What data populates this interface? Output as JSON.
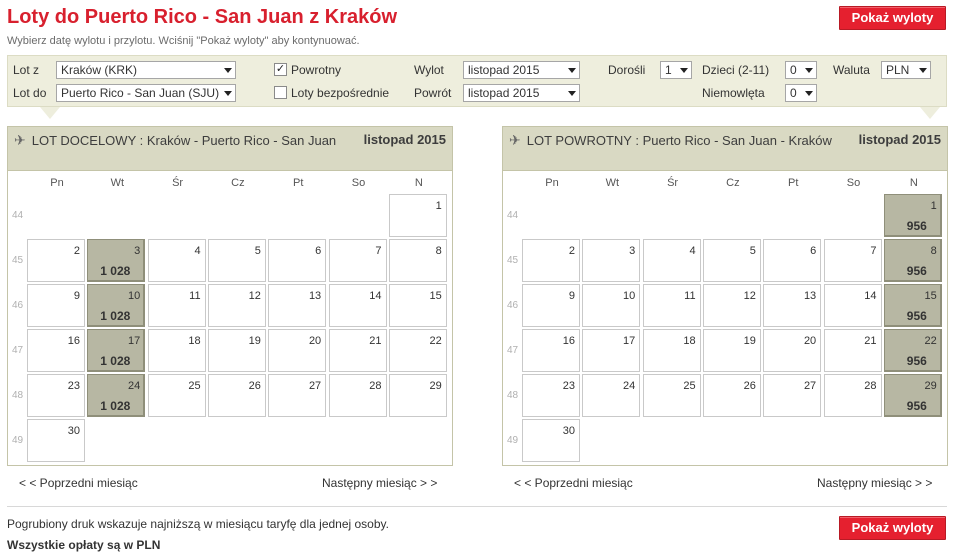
{
  "header": {
    "title": "Loty do Puerto Rico - San Juan z Kraków",
    "subtitle": "Wybierz datę wylotu i przylotu. Wciśnij \"Pokaż wyloty\" aby kontynuować.",
    "show_button": "Pokaż wyloty"
  },
  "form": {
    "from_label": "Lot z",
    "from_value": "Kraków (KRK)",
    "to_label": "Lot do",
    "to_value": "Puerto Rico - San Juan (SJU)",
    "return_label": "Powrotny",
    "return_checked": "✓",
    "direct_label": "Loty bezpośrednie",
    "direct_checked": "",
    "depart_label": "Wylot",
    "depart_value": "listopad 2015",
    "return_date_label": "Powrót",
    "return_date_value": "listopad 2015",
    "adults_label": "Dorośli",
    "adults_value": "1",
    "children_label": "Dzieci (2-11)",
    "children_value": "0",
    "infants_label": "Niemowlęta",
    "infants_value": "0",
    "currency_label": "Waluta",
    "currency_value": "PLN"
  },
  "weekdays": [
    "Pn",
    "Wt",
    "Śr",
    "Cz",
    "Pt",
    "So",
    "N"
  ],
  "calendars": [
    {
      "label": "LOT DOCELOWY :",
      "route": "Kraków - Puerto Rico - San Juan",
      "month": "listopad 2015",
      "week_numbers": [
        "44",
        "45",
        "46",
        "47",
        "48",
        "49"
      ],
      "weeks": [
        [
          null,
          null,
          null,
          null,
          null,
          null,
          {
            "day": "1"
          }
        ],
        [
          {
            "day": "2"
          },
          {
            "day": "3",
            "price": "1 028"
          },
          {
            "day": "4"
          },
          {
            "day": "5"
          },
          {
            "day": "6"
          },
          {
            "day": "7"
          },
          {
            "day": "8"
          }
        ],
        [
          {
            "day": "9"
          },
          {
            "day": "10",
            "price": "1 028"
          },
          {
            "day": "11"
          },
          {
            "day": "12"
          },
          {
            "day": "13"
          },
          {
            "day": "14"
          },
          {
            "day": "15"
          }
        ],
        [
          {
            "day": "16"
          },
          {
            "day": "17",
            "price": "1 028"
          },
          {
            "day": "18"
          },
          {
            "day": "19"
          },
          {
            "day": "20"
          },
          {
            "day": "21"
          },
          {
            "day": "22"
          }
        ],
        [
          {
            "day": "23"
          },
          {
            "day": "24",
            "price": "1 028"
          },
          {
            "day": "25"
          },
          {
            "day": "26"
          },
          {
            "day": "27"
          },
          {
            "day": "28"
          },
          {
            "day": "29"
          }
        ],
        [
          {
            "day": "30"
          },
          null,
          null,
          null,
          null,
          null,
          null
        ]
      ],
      "prev": "< < Poprzedni miesiąc",
      "next": "Następny miesiąc > >"
    },
    {
      "label": "LOT POWROTNY :",
      "route": "Puerto Rico - San Juan - Kraków",
      "month": "listopad 2015",
      "week_numbers": [
        "44",
        "45",
        "46",
        "47",
        "48",
        "49"
      ],
      "weeks": [
        [
          null,
          null,
          null,
          null,
          null,
          null,
          {
            "day": "1",
            "price": "956"
          }
        ],
        [
          {
            "day": "2"
          },
          {
            "day": "3"
          },
          {
            "day": "4"
          },
          {
            "day": "5"
          },
          {
            "day": "6"
          },
          {
            "day": "7"
          },
          {
            "day": "8",
            "price": "956"
          }
        ],
        [
          {
            "day": "9"
          },
          {
            "day": "10"
          },
          {
            "day": "11"
          },
          {
            "day": "12"
          },
          {
            "day": "13"
          },
          {
            "day": "14"
          },
          {
            "day": "15",
            "price": "956"
          }
        ],
        [
          {
            "day": "16"
          },
          {
            "day": "17"
          },
          {
            "day": "18"
          },
          {
            "day": "19"
          },
          {
            "day": "20"
          },
          {
            "day": "21"
          },
          {
            "day": "22",
            "price": "956"
          }
        ],
        [
          {
            "day": "23"
          },
          {
            "day": "24"
          },
          {
            "day": "25"
          },
          {
            "day": "26"
          },
          {
            "day": "27"
          },
          {
            "day": "28"
          },
          {
            "day": "29",
            "price": "956"
          }
        ],
        [
          {
            "day": "30"
          },
          null,
          null,
          null,
          null,
          null,
          null
        ]
      ],
      "prev": "< < Poprzedni miesiąc",
      "next": "Następny miesiąc > >"
    }
  ],
  "footer": {
    "note1": "Pogrubiony druk wskazuje najniższą w miesiącu taryfę dla jednej osoby.",
    "note2": "Wszystkie opłaty są w PLN",
    "show_button": "Pokaż wyloty"
  },
  "colors": {
    "accent_red": "#e5202f",
    "title_red": "#d8202e",
    "panel_bg": "#eeeedd",
    "cal_header_bg": "#d9d9c3",
    "price_cell_bg": "#b7b7a3"
  }
}
